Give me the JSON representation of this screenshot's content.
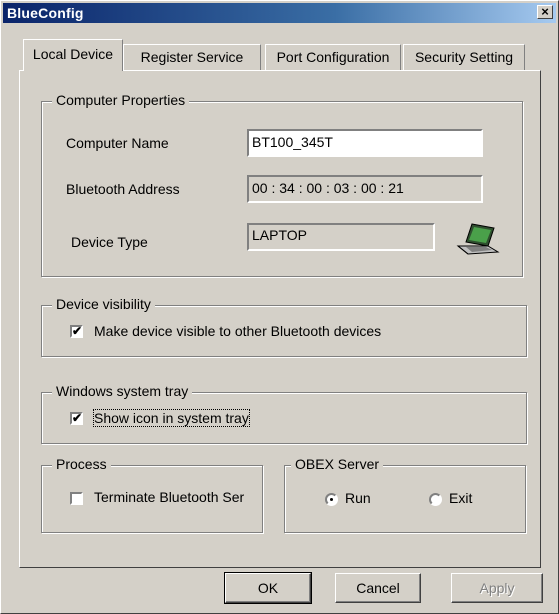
{
  "window": {
    "title": "BlueConfig",
    "close_glyph": "×"
  },
  "tabs": [
    {
      "label": "Local Device",
      "active": true
    },
    {
      "label": "Register Service",
      "active": false
    },
    {
      "label": "Port Configuration",
      "active": false
    },
    {
      "label": "Security Setting",
      "active": false
    }
  ],
  "computer_properties": {
    "legend": "Computer Properties",
    "name_label": "Computer Name",
    "name_value": "BT100_345T",
    "address_label": "Bluetooth Address",
    "address_value": "00 : 34 : 00 : 03 : 00 : 21",
    "type_label": "Device Type",
    "type_value": "LAPTOP",
    "type_icon": "laptop-icon"
  },
  "device_visibility": {
    "legend": "Device visibility",
    "checkbox_label": "Make device visible to other Bluetooth devices",
    "checked": true
  },
  "system_tray": {
    "legend": "Windows system tray",
    "checkbox_label": "Show icon in system tray",
    "checked": true
  },
  "process": {
    "legend": "Process",
    "checkbox_label": "Terminate Bluetooth Ser",
    "checked": false
  },
  "obex": {
    "legend": "OBEX Server",
    "run_label": "Run",
    "exit_label": "Exit",
    "selected": "Run"
  },
  "buttons": {
    "ok": "OK",
    "cancel": "Cancel",
    "apply": "Apply"
  },
  "colors": {
    "face": "#d4d0c8",
    "title_start": "#0a246a",
    "title_end": "#a6caf0"
  },
  "check_glyph": "✔"
}
